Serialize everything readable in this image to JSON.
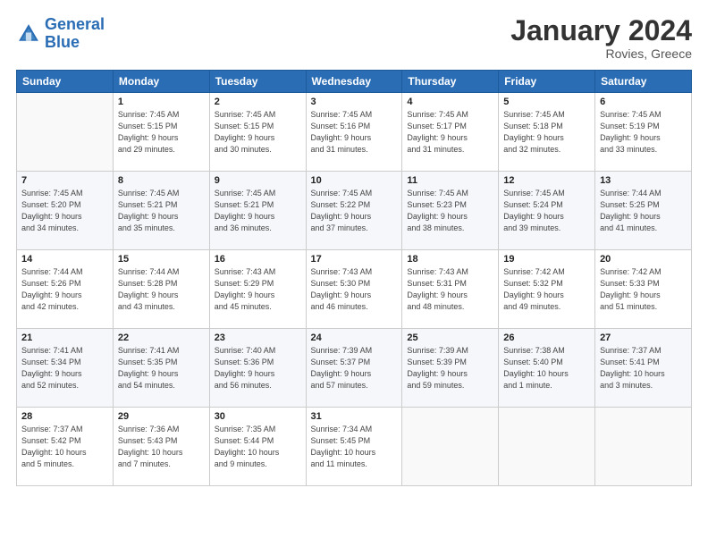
{
  "header": {
    "logo_line1": "General",
    "logo_line2": "Blue",
    "month": "January 2024",
    "location": "Rovies, Greece"
  },
  "weekdays": [
    "Sunday",
    "Monday",
    "Tuesday",
    "Wednesday",
    "Thursday",
    "Friday",
    "Saturday"
  ],
  "weeks": [
    [
      {
        "day": "",
        "info": ""
      },
      {
        "day": "1",
        "info": "Sunrise: 7:45 AM\nSunset: 5:15 PM\nDaylight: 9 hours\nand 29 minutes."
      },
      {
        "day": "2",
        "info": "Sunrise: 7:45 AM\nSunset: 5:15 PM\nDaylight: 9 hours\nand 30 minutes."
      },
      {
        "day": "3",
        "info": "Sunrise: 7:45 AM\nSunset: 5:16 PM\nDaylight: 9 hours\nand 31 minutes."
      },
      {
        "day": "4",
        "info": "Sunrise: 7:45 AM\nSunset: 5:17 PM\nDaylight: 9 hours\nand 31 minutes."
      },
      {
        "day": "5",
        "info": "Sunrise: 7:45 AM\nSunset: 5:18 PM\nDaylight: 9 hours\nand 32 minutes."
      },
      {
        "day": "6",
        "info": "Sunrise: 7:45 AM\nSunset: 5:19 PM\nDaylight: 9 hours\nand 33 minutes."
      }
    ],
    [
      {
        "day": "7",
        "info": "Sunrise: 7:45 AM\nSunset: 5:20 PM\nDaylight: 9 hours\nand 34 minutes."
      },
      {
        "day": "8",
        "info": "Sunrise: 7:45 AM\nSunset: 5:21 PM\nDaylight: 9 hours\nand 35 minutes."
      },
      {
        "day": "9",
        "info": "Sunrise: 7:45 AM\nSunset: 5:21 PM\nDaylight: 9 hours\nand 36 minutes."
      },
      {
        "day": "10",
        "info": "Sunrise: 7:45 AM\nSunset: 5:22 PM\nDaylight: 9 hours\nand 37 minutes."
      },
      {
        "day": "11",
        "info": "Sunrise: 7:45 AM\nSunset: 5:23 PM\nDaylight: 9 hours\nand 38 minutes."
      },
      {
        "day": "12",
        "info": "Sunrise: 7:45 AM\nSunset: 5:24 PM\nDaylight: 9 hours\nand 39 minutes."
      },
      {
        "day": "13",
        "info": "Sunrise: 7:44 AM\nSunset: 5:25 PM\nDaylight: 9 hours\nand 41 minutes."
      }
    ],
    [
      {
        "day": "14",
        "info": "Sunrise: 7:44 AM\nSunset: 5:26 PM\nDaylight: 9 hours\nand 42 minutes."
      },
      {
        "day": "15",
        "info": "Sunrise: 7:44 AM\nSunset: 5:28 PM\nDaylight: 9 hours\nand 43 minutes."
      },
      {
        "day": "16",
        "info": "Sunrise: 7:43 AM\nSunset: 5:29 PM\nDaylight: 9 hours\nand 45 minutes."
      },
      {
        "day": "17",
        "info": "Sunrise: 7:43 AM\nSunset: 5:30 PM\nDaylight: 9 hours\nand 46 minutes."
      },
      {
        "day": "18",
        "info": "Sunrise: 7:43 AM\nSunset: 5:31 PM\nDaylight: 9 hours\nand 48 minutes."
      },
      {
        "day": "19",
        "info": "Sunrise: 7:42 AM\nSunset: 5:32 PM\nDaylight: 9 hours\nand 49 minutes."
      },
      {
        "day": "20",
        "info": "Sunrise: 7:42 AM\nSunset: 5:33 PM\nDaylight: 9 hours\nand 51 minutes."
      }
    ],
    [
      {
        "day": "21",
        "info": "Sunrise: 7:41 AM\nSunset: 5:34 PM\nDaylight: 9 hours\nand 52 minutes."
      },
      {
        "day": "22",
        "info": "Sunrise: 7:41 AM\nSunset: 5:35 PM\nDaylight: 9 hours\nand 54 minutes."
      },
      {
        "day": "23",
        "info": "Sunrise: 7:40 AM\nSunset: 5:36 PM\nDaylight: 9 hours\nand 56 minutes."
      },
      {
        "day": "24",
        "info": "Sunrise: 7:39 AM\nSunset: 5:37 PM\nDaylight: 9 hours\nand 57 minutes."
      },
      {
        "day": "25",
        "info": "Sunrise: 7:39 AM\nSunset: 5:39 PM\nDaylight: 9 hours\nand 59 minutes."
      },
      {
        "day": "26",
        "info": "Sunrise: 7:38 AM\nSunset: 5:40 PM\nDaylight: 10 hours\nand 1 minute."
      },
      {
        "day": "27",
        "info": "Sunrise: 7:37 AM\nSunset: 5:41 PM\nDaylight: 10 hours\nand 3 minutes."
      }
    ],
    [
      {
        "day": "28",
        "info": "Sunrise: 7:37 AM\nSunset: 5:42 PM\nDaylight: 10 hours\nand 5 minutes."
      },
      {
        "day": "29",
        "info": "Sunrise: 7:36 AM\nSunset: 5:43 PM\nDaylight: 10 hours\nand 7 minutes."
      },
      {
        "day": "30",
        "info": "Sunrise: 7:35 AM\nSunset: 5:44 PM\nDaylight: 10 hours\nand 9 minutes."
      },
      {
        "day": "31",
        "info": "Sunrise: 7:34 AM\nSunset: 5:45 PM\nDaylight: 10 hours\nand 11 minutes."
      },
      {
        "day": "",
        "info": ""
      },
      {
        "day": "",
        "info": ""
      },
      {
        "day": "",
        "info": ""
      }
    ]
  ]
}
